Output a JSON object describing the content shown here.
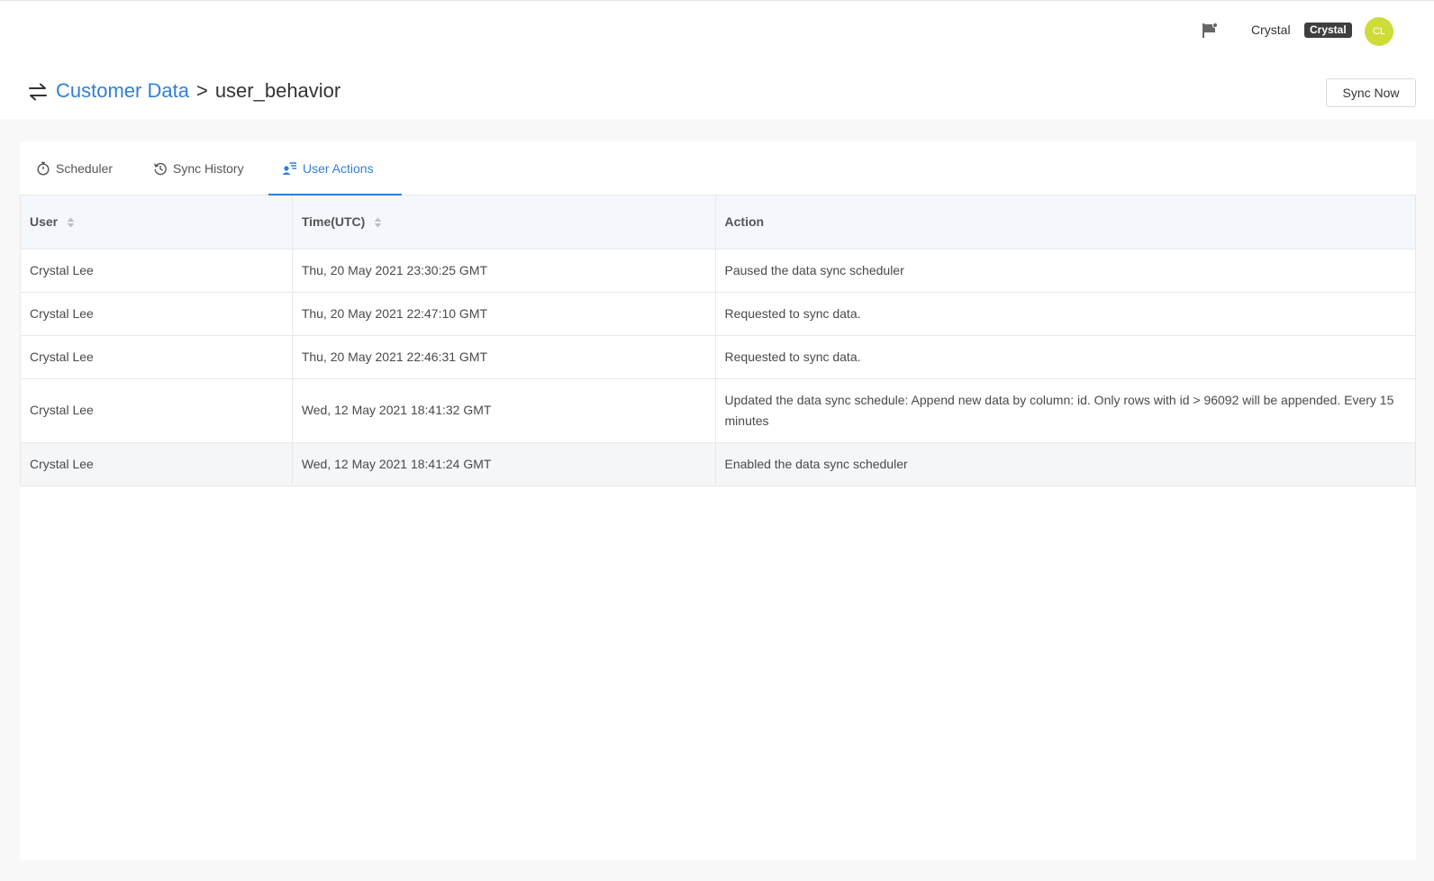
{
  "topbar": {
    "user_name": "Crystal",
    "user_tag": "Crystal",
    "avatar_initials": "CL",
    "avatar_color": "#cddc3a"
  },
  "header": {
    "breadcrumb_parent": "Customer Data",
    "breadcrumb_separator": ">",
    "breadcrumb_current": "user_behavior",
    "sync_button": "Sync Now"
  },
  "tabs": [
    {
      "label": "Scheduler",
      "icon": "stopwatch-icon",
      "active": false
    },
    {
      "label": "Sync History",
      "icon": "history-icon",
      "active": false
    },
    {
      "label": "User Actions",
      "icon": "user-list-icon",
      "active": true
    }
  ],
  "table": {
    "columns": [
      "User",
      "Time(UTC)",
      "Action"
    ],
    "rows": [
      {
        "user": "Crystal Lee",
        "time": "Thu, 20 May 2021 23:30:25 GMT",
        "action": "Paused the data sync scheduler"
      },
      {
        "user": "Crystal Lee",
        "time": "Thu, 20 May 2021 22:47:10 GMT",
        "action": "Requested to sync data."
      },
      {
        "user": "Crystal Lee",
        "time": "Thu, 20 May 2021 22:46:31 GMT",
        "action": "Requested to sync data."
      },
      {
        "user": "Crystal Lee",
        "time": "Wed, 12 May 2021 18:41:32 GMT",
        "action": "Updated the data sync schedule: Append new data by column: id. Only rows with id > 96092 will be appended. Every 15 minutes"
      },
      {
        "user": "Crystal Lee",
        "time": "Wed, 12 May 2021 18:41:24 GMT",
        "action": "Enabled the data sync scheduler"
      }
    ]
  },
  "colors": {
    "accent": "#2f7fd8",
    "header_row": "#f4f7fc"
  }
}
